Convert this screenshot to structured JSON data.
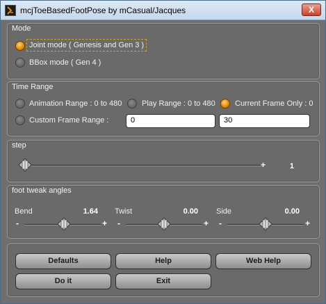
{
  "window": {
    "title": "mcjToeBasedFootPose by mCasual/Jacques",
    "close_label": "X"
  },
  "mode": {
    "title": "Mode",
    "options": [
      {
        "label": "Joint mode ( Genesis and Gen 3 )",
        "checked": true
      },
      {
        "label": "BBox mode ( Gen 4 )",
        "checked": false
      }
    ]
  },
  "time_range": {
    "title": "Time Range",
    "options": [
      {
        "label": "Animation Range : 0 to 480",
        "checked": false
      },
      {
        "label": "Play Range : 0 to 480",
        "checked": false
      },
      {
        "label": "Current Frame Only : 0",
        "checked": true
      },
      {
        "label": "Custom Frame Range :",
        "checked": false
      }
    ],
    "range_start": "0",
    "range_end": "30"
  },
  "step": {
    "title": "step",
    "value": "1",
    "plus": "+",
    "level": 0.0
  },
  "foot_tweak": {
    "title": "foot tweak angles",
    "sliders": [
      {
        "label": "Bend",
        "value": "1.64",
        "minus": "-",
        "plus": "+"
      },
      {
        "label": "Twist",
        "value": "0.00",
        "minus": "-",
        "plus": "+"
      },
      {
        "label": "Side",
        "value": "0.00",
        "minus": "-",
        "plus": "+"
      }
    ]
  },
  "buttons": {
    "defaults": "Defaults",
    "help": "Help",
    "web_help": "Web Help",
    "do_it": "Do it",
    "exit": "Exit"
  }
}
